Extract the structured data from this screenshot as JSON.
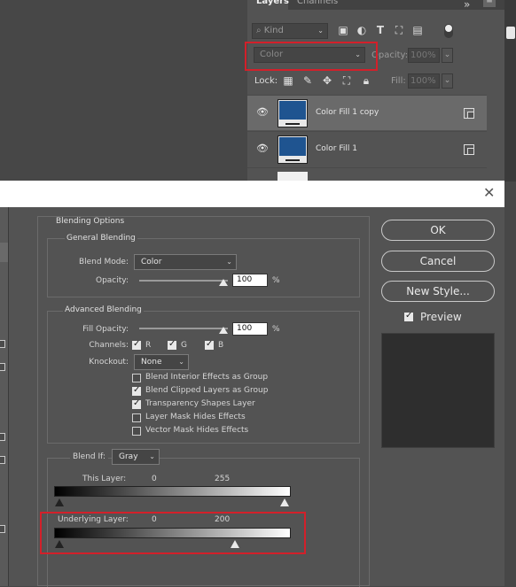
{
  "layers_panel": {
    "tabs": [
      "Layers",
      "Channels"
    ],
    "menu_glyph": "»",
    "close_glyph": "≡",
    "kind_placeholder": "Kind",
    "blend_mode": "Color",
    "opacity_label": "Opacity:",
    "opacity_value": "100%",
    "lock_label": "Lock:",
    "fill_label": "Fill:",
    "fill_value": "100%",
    "layers": [
      {
        "name": "Color Fill 1 copy",
        "selected": true,
        "fill_color": "#1f5490"
      },
      {
        "name": "Color Fill 1",
        "selected": false,
        "fill_color": "#1f5490"
      },
      {
        "name": "",
        "selected": false
      }
    ]
  },
  "dialog": {
    "close_glyph": "✕",
    "blending_options_title": "Blending Options",
    "general": {
      "title": "General Blending",
      "blend_mode_label": "Blend Mode:",
      "blend_mode_value": "Color",
      "opacity_label": "Opacity:",
      "opacity_value": "100",
      "percent": "%"
    },
    "advanced": {
      "title": "Advanced Blending",
      "fill_opacity_label": "Fill Opacity:",
      "fill_opacity_value": "100",
      "percent": "%",
      "channels_label": "Channels:",
      "channels": [
        {
          "label": "R",
          "checked": true
        },
        {
          "label": "G",
          "checked": true
        },
        {
          "label": "B",
          "checked": true
        }
      ],
      "knockout_label": "Knockout:",
      "knockout_value": "None",
      "options": [
        {
          "label": "Blend Interior Effects as Group",
          "checked": false
        },
        {
          "label": "Blend Clipped Layers as Group",
          "checked": true
        },
        {
          "label": "Transparency Shapes Layer",
          "checked": true
        },
        {
          "label": "Layer Mask Hides Effects",
          "checked": false
        },
        {
          "label": "Vector Mask Hides Effects",
          "checked": false
        }
      ]
    },
    "blend_if": {
      "label": "Blend If:",
      "value": "Gray",
      "this_layer_label": "This Layer:",
      "this_layer_low": "0",
      "this_layer_high": "255",
      "underlying_label": "Underlying Layer:",
      "underlying_low": "0",
      "underlying_high": "200"
    },
    "buttons": {
      "ok": "OK",
      "cancel": "Cancel",
      "new_style": "New Style...",
      "preview_label": "Preview",
      "preview_checked": true
    }
  }
}
